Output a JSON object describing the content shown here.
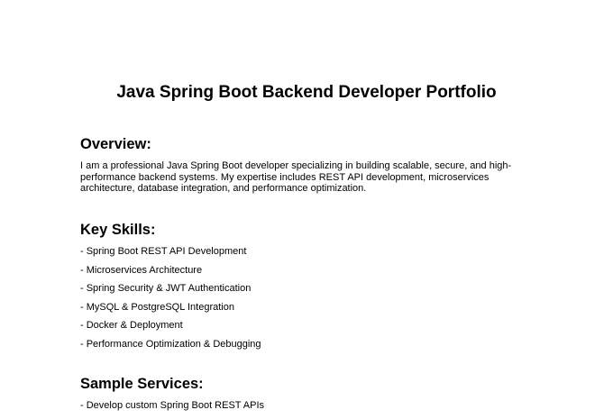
{
  "document": {
    "title": "Java Spring Boot Backend Developer Portfolio",
    "overview": {
      "heading": "Overview:",
      "text": "I am a professional Java Spring Boot developer specializing in building scalable, secure, and high-performance backend systems. My expertise includes REST API development, microservices architecture, database integration, and performance optimization."
    },
    "skills": {
      "heading": "Key Skills:",
      "items": [
        "- Spring Boot REST API Development",
        "- Microservices Architecture",
        "- Spring Security & JWT Authentication",
        "- MySQL & PostgreSQL Integration",
        "- Docker & Deployment",
        "- Performance Optimization & Debugging"
      ]
    },
    "services": {
      "heading": "Sample Services:",
      "items": [
        "- Develop custom Spring Boot REST APIs"
      ]
    }
  }
}
